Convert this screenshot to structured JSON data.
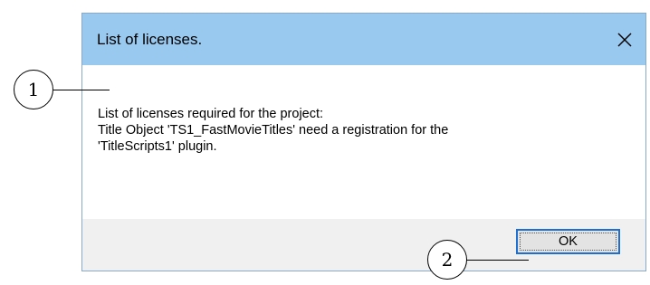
{
  "dialog": {
    "title": "List of licenses.",
    "close_icon": "close-icon",
    "message_lines": [
      "List of licenses required for the project:",
      "Title Object 'TS1_FastMovieTitles' need a registration for the",
      "'TitleScripts1' plugin."
    ],
    "ok_label": "OK"
  },
  "callouts": {
    "one": "1",
    "two": "2"
  },
  "colors": {
    "titlebar": "#99c9ef",
    "footer": "#f0f0f0",
    "button_border": "#1f6fd1"
  }
}
